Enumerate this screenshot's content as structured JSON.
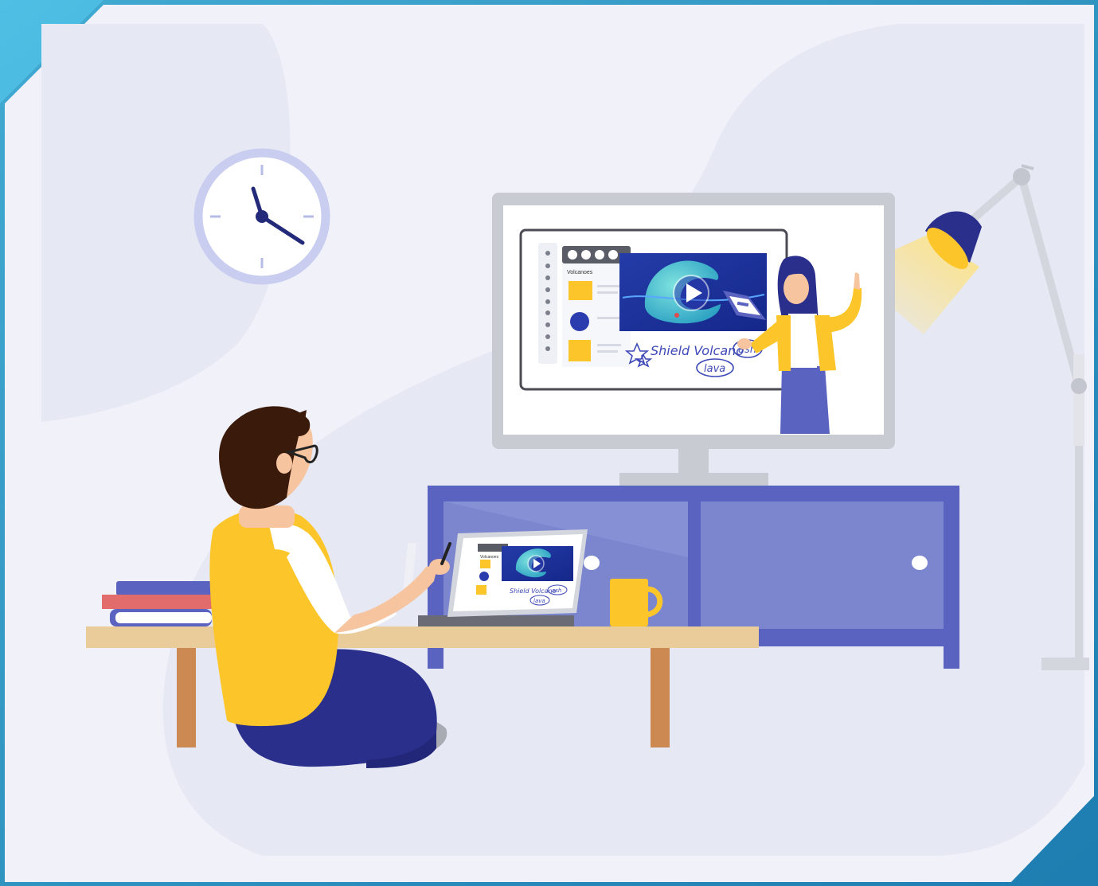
{
  "colors": {
    "frame": "#2f9ccf",
    "background": "#f0f1f9",
    "blob": "#e6e8f3",
    "indigo": "#5a63c0",
    "yellow": "#fcc62b",
    "navy": "#2a2f8c",
    "monitor_gray": "#c9cbd3",
    "desk_wood": "#eacb9a",
    "desk_legs": "#cc8a52",
    "hair": "#3a1a0b",
    "skin": "#f7c4a0",
    "lamp_gray": "#d4d6dd"
  },
  "icons": {
    "play": "play-icon",
    "clock": "clock-icon",
    "lamp": "desk-lamp-icon"
  },
  "tv_screen": {
    "toolbar_title": "Volcanoes",
    "annotation_main": "Shield Volcano",
    "annotation_ash": "ash",
    "annotation_lava": "lava"
  },
  "tablet_screen": {
    "toolbar_title": "Volcanoes",
    "annotation_main": "Shield Volcano",
    "annotation_ash": "ash",
    "annotation_lava": "lava"
  }
}
